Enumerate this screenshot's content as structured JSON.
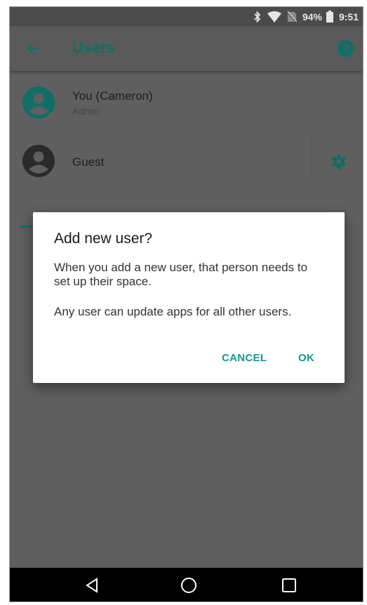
{
  "status_bar": {
    "icons": [
      "bluetooth-icon",
      "wifi-icon",
      "no-sim-icon",
      "battery-icon"
    ],
    "battery": "94%",
    "time": "9:51"
  },
  "app_bar": {
    "title": "Users",
    "icons": [
      "back-arrow-icon",
      "help-icon"
    ]
  },
  "users": [
    {
      "name": "You (Cameron)",
      "role": "Admin",
      "icon": "account-circle-icon"
    },
    {
      "name": "Guest",
      "icon": "account-circle-icon",
      "settings_icon": "gear-icon"
    }
  ],
  "dialog": {
    "title": "Add new user?",
    "message_1": "When you add a new user, that person needs to set up their space.",
    "message_2": "Any user can update apps for all other users.",
    "cancel": "CANCEL",
    "ok": "OK"
  },
  "nav_bar": {
    "icons": [
      "back-triangle-icon",
      "home-circle-icon",
      "recents-square-icon"
    ]
  },
  "colors": {
    "accent": "#0f6e68",
    "dialog_button": "#119a8e",
    "scrim_background": "#5f5f5f"
  }
}
